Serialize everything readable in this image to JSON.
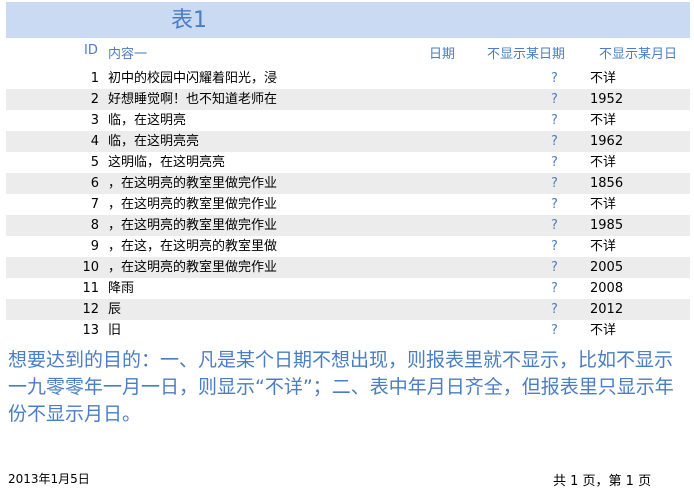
{
  "report": {
    "title": "表1",
    "columns": {
      "id": "ID",
      "content": "内容一",
      "date": "日期",
      "hide_date": "不显示某日期",
      "hide_month_day": "不显示某月日"
    },
    "rows": [
      {
        "id": "1",
        "content": "初中的校园中闪耀着阳光，浸",
        "q": "?",
        "year": "不详"
      },
      {
        "id": "2",
        "content": "好想睡觉啊！也不知道老师在",
        "q": "?",
        "year": "1952"
      },
      {
        "id": "3",
        "content": "临，在这明亮",
        "q": "?",
        "year": "不详"
      },
      {
        "id": "4",
        "content": "临，在这明亮亮",
        "q": "?",
        "year": "1962"
      },
      {
        "id": "5",
        "content": "这明临，在这明亮亮",
        "q": "?",
        "year": "不详"
      },
      {
        "id": "6",
        "content": "，在这明亮的教室里做完作业",
        "q": "?",
        "year": "1856"
      },
      {
        "id": "7",
        "content": "，在这明亮的教室里做完作业",
        "q": "?",
        "year": "不详"
      },
      {
        "id": "8",
        "content": "，在这明亮的教室里做完作业",
        "q": "?",
        "year": "1985"
      },
      {
        "id": "9",
        "content": "，在这，在这明亮的教室里做",
        "q": "?",
        "year": "不详"
      },
      {
        "id": "10",
        "content": "，在这明亮的教室里做完作业",
        "q": "?",
        "year": "2005"
      },
      {
        "id": "11",
        "content": "降雨",
        "q": "?",
        "year": "2008"
      },
      {
        "id": "12",
        "content": "辰",
        "q": "?",
        "year": "2012"
      },
      {
        "id": "13",
        "content": "旧",
        "q": "?",
        "year": "不详"
      }
    ]
  },
  "note": "想要达到的目的：一、凡是某个日期不想出现，则报表里就不显示，比如不显示一九零零年一月一日，则显示“不详”；二、表中年月日齐全，但报表里只显示年份不显示月日。",
  "footer": {
    "date": "2013年1月5日",
    "pages": "共 1 页，第 1 页"
  }
}
